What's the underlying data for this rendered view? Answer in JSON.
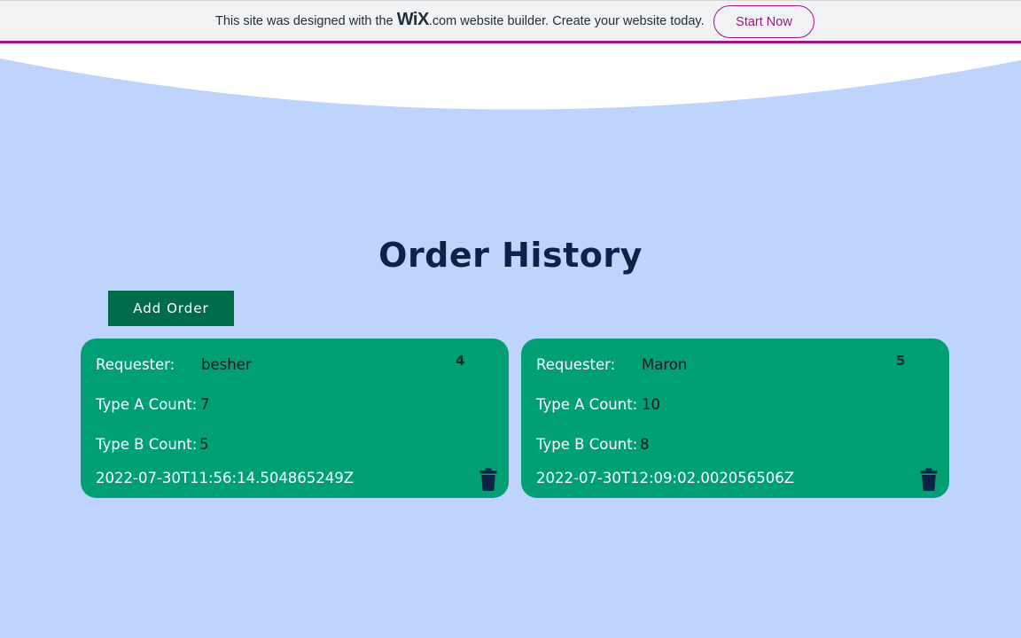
{
  "banner": {
    "text_before": "This site was designed with the",
    "logo": "WiX",
    "text_after": ".com website builder. Create your website today.",
    "cta": "Start Now",
    "accent_color": "#a0138e"
  },
  "page": {
    "title": "Order History",
    "add_order_label": "Add Order",
    "background_color": "#bed4fd",
    "card_color": "#009f74",
    "button_color": "#006c4b"
  },
  "labels": {
    "requester": "Requester:",
    "type_a": "Type A Count:",
    "type_b": "Type B Count:"
  },
  "orders": [
    {
      "id": "4",
      "requester": "besher",
      "type_a_count": "7",
      "type_b_count": "5",
      "timestamp": "2022-07-30T11:56:14.504865249Z",
      "delete_icon": "trash-icon"
    },
    {
      "id": "5",
      "requester": "Maron",
      "type_a_count": "10",
      "type_b_count": "8",
      "timestamp": "2022-07-30T12:09:02.002056506Z",
      "delete_icon": "trash-icon"
    }
  ]
}
